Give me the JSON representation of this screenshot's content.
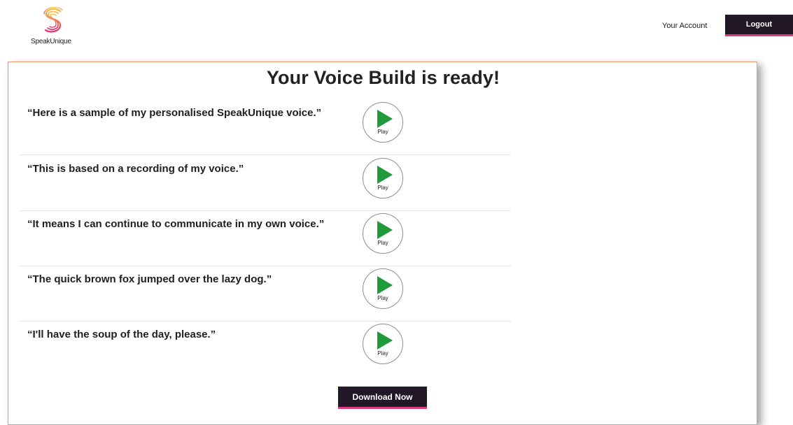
{
  "brand": {
    "name": "SpeakUnique",
    "accent_color": "#e0387a",
    "logo_gradient": [
      "#f5c24b",
      "#ef7a52",
      "#e0387a"
    ]
  },
  "header": {
    "account_link": "Your Account",
    "logout_label": "Logout"
  },
  "main": {
    "title": "Your Voice Build is ready!",
    "samples": [
      {
        "text": "“Here is a sample of my personalised SpeakUnique voice.”",
        "play_label": "Play"
      },
      {
        "text": "“This is based on a recording of my voice.”",
        "play_label": "Play"
      },
      {
        "text": "“It means I can continue to communicate in my own voice.”",
        "play_label": "Play"
      },
      {
        "text": "“The quick brown fox jumped over the lazy dog.”",
        "play_label": "Play"
      },
      {
        "text": "“I'll have the soup of the day, please.”",
        "play_label": "Play"
      }
    ],
    "download_label": "Download Now"
  },
  "colors": {
    "dark_button": "#221726",
    "play_icon": "#1f9b3c",
    "panel_border": "#f0956d"
  },
  "icons": {
    "logo": "speakunique-s-logo",
    "play": "play-triangle-icon"
  }
}
